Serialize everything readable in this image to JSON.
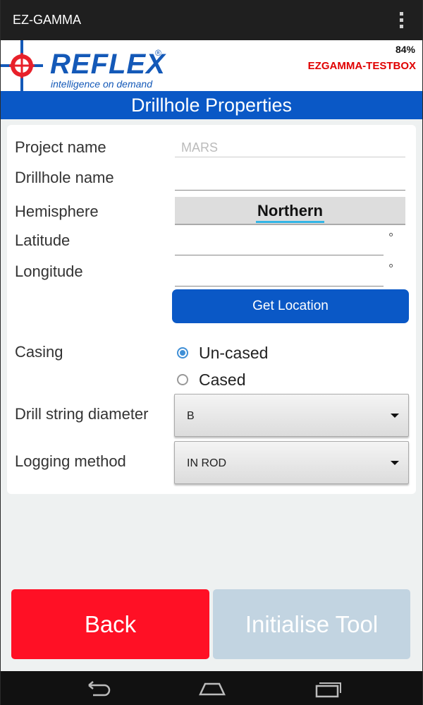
{
  "app": {
    "title": "EZ-GAMMA"
  },
  "header": {
    "brand": "REFLEX",
    "registered": "®",
    "tagline": "intelligence on demand",
    "battery": "84%",
    "device_name": "EZGAMMA-TESTBOX",
    "device_color": "#e00000"
  },
  "section_title": "Drillhole Properties",
  "form": {
    "project_label": "Project name",
    "project_value": "MARS",
    "drillhole_label": "Drillhole name",
    "drillhole_value": "",
    "hemisphere_label": "Hemisphere",
    "hemisphere_value": "Northern",
    "latitude_label": "Latitude",
    "latitude_value": "",
    "longitude_label": "Longitude",
    "longitude_value": "",
    "degree_symbol": "°",
    "get_location_label": "Get Location",
    "casing_label": "Casing",
    "casing_options": [
      "Un-cased",
      "Cased"
    ],
    "casing_selected": "Un-cased",
    "drill_diameter_label": "Drill string diameter",
    "drill_diameter_value": "B",
    "logging_method_label": "Logging method",
    "logging_method_value": "IN ROD"
  },
  "buttons": {
    "back": "Back",
    "initialise": "Initialise Tool"
  },
  "colors": {
    "accent_blue": "#0a58c6",
    "back_red": "#ff1025",
    "disabled": "#c2d4e1"
  },
  "navbar": {
    "icons": [
      "back-icon",
      "home-icon",
      "recent-apps-icon"
    ]
  }
}
